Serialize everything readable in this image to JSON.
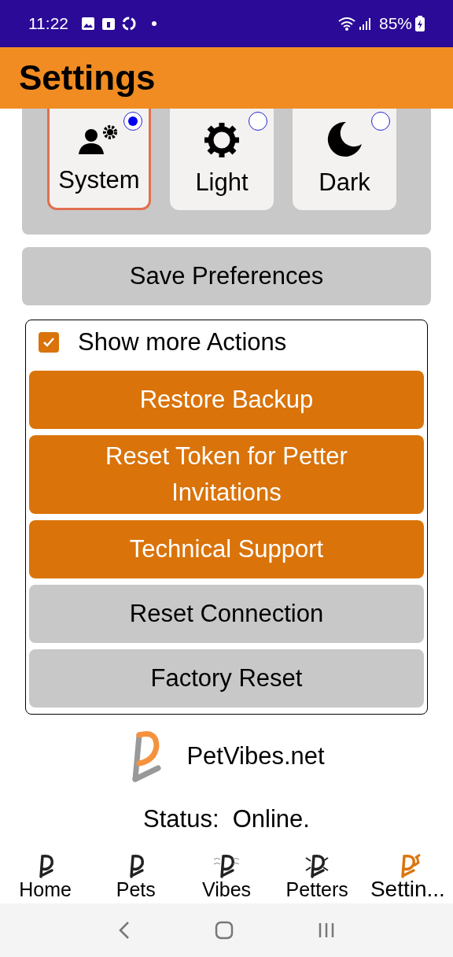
{
  "status_bar": {
    "time": "11:22",
    "battery": "85%"
  },
  "header": {
    "title": "Settings"
  },
  "themes": [
    {
      "label": "System",
      "kind": "system",
      "selected": true
    },
    {
      "label": "Light",
      "kind": "light",
      "selected": false
    },
    {
      "label": "Dark",
      "kind": "dark",
      "selected": false
    }
  ],
  "save_button": "Save Preferences",
  "more_actions": {
    "label": "Show more Actions",
    "checked": true,
    "buttons": [
      {
        "label": "Restore Backup",
        "kind": "primary"
      },
      {
        "label": "Reset Token for Petter Invitations",
        "kind": "primary"
      },
      {
        "label": "Technical Support",
        "kind": "primary"
      },
      {
        "label": "Reset Connection",
        "kind": "secondary"
      },
      {
        "label": "Factory Reset",
        "kind": "secondary"
      }
    ]
  },
  "brand": "PetVibes.net",
  "status": "Status:  Online.",
  "tabs": [
    {
      "label": "Home",
      "selected": false
    },
    {
      "label": "Pets",
      "selected": false
    },
    {
      "label": "Vibes",
      "selected": false
    },
    {
      "label": "Petters",
      "selected": false
    },
    {
      "label": "Settin...",
      "selected": true
    }
  ]
}
